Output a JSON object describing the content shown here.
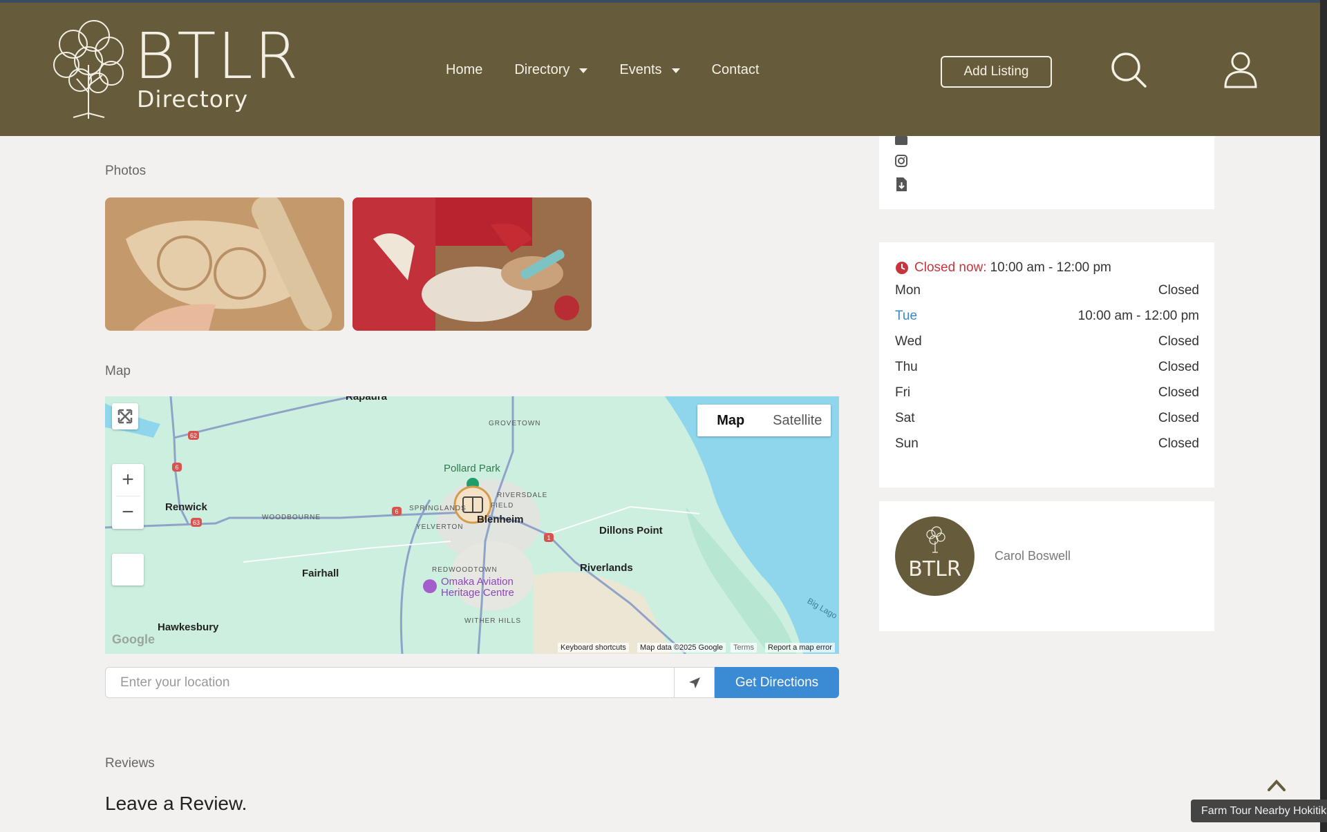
{
  "brand": {
    "name_big": "BTLR",
    "name_small": "Directory",
    "avatar_text": "BTLR"
  },
  "nav": {
    "items": [
      {
        "label": "Home",
        "dropdown": false
      },
      {
        "label": "Directory",
        "dropdown": true
      },
      {
        "label": "Events",
        "dropdown": true
      },
      {
        "label": "Contact",
        "dropdown": false
      }
    ],
    "add_listing": "Add Listing"
  },
  "sections": {
    "photos": "Photos",
    "map": "Map",
    "reviews": "Reviews",
    "leave_review": "Leave a Review."
  },
  "map": {
    "type_map": "Map",
    "type_satellite": "Satellite",
    "places": {
      "kapuaka": "Rapaura",
      "grovetown": "GROVETOWN",
      "pollard_park": "Pollard Park",
      "riversdale": "RIVERSDALE",
      "renwick": "Renwick",
      "woodbourne": "WOODBOURNE",
      "springlands": "SPRINGLANDS",
      "field": "FIELD",
      "yelverton": "YELVERTON",
      "blenheim": "Blenheim",
      "dillons_point": "Dillons Point",
      "riverlands": "Riverlands",
      "fairhall": "Fairhall",
      "redwoodtown": "REDWOODTOWN",
      "omaka_1": "Omaka Aviation",
      "omaka_2": "Heritage Centre",
      "witherhills": "WITHER HILLS",
      "hawkesbury": "Hawkesbury",
      "big_lagoon": "Big Lago"
    },
    "road_shields": [
      "62",
      "6",
      "63",
      "6",
      "1"
    ],
    "google": "Google",
    "footer": {
      "shortcuts": "Keyboard shortcuts",
      "data": "Map data ©2025 Google",
      "terms": "Terms",
      "report": "Report a map error"
    }
  },
  "directions": {
    "placeholder": "Enter your location",
    "button": "Get Directions"
  },
  "hours": {
    "status_label": "Closed now:",
    "status_time": "10:00 am - 12:00 pm",
    "days": [
      {
        "day": "Mon",
        "value": "Closed",
        "today": false
      },
      {
        "day": "Tue",
        "value": "10:00 am - 12:00 pm",
        "today": true
      },
      {
        "day": "Wed",
        "value": "Closed",
        "today": false
      },
      {
        "day": "Thu",
        "value": "Closed",
        "today": false
      },
      {
        "day": "Fri",
        "value": "Closed",
        "today": false
      },
      {
        "day": "Sat",
        "value": "Closed",
        "today": false
      },
      {
        "day": "Sun",
        "value": "Closed",
        "today": false
      }
    ]
  },
  "author": {
    "name": "Carol Boswell"
  },
  "tooltip": "Farm Tour Nearby Hokitika",
  "colors": {
    "header": "#665b3b",
    "accent": "#3a8ad4",
    "closed": "#c7353c",
    "today": "#3a87c7"
  }
}
